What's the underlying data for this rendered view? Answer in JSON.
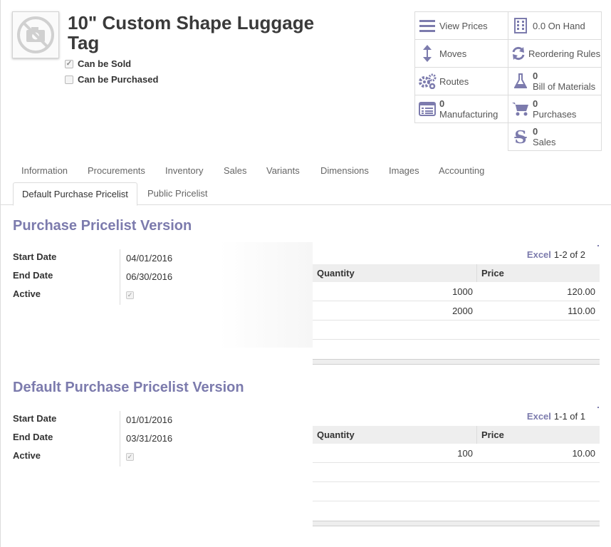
{
  "product": {
    "title": "10\" Custom Shape Luggage Tag",
    "can_be_sold_label": "Can be Sold",
    "can_be_sold": true,
    "can_be_purchased_label": "Can be Purchased",
    "can_be_purchased": false
  },
  "smart_buttons": {
    "view_prices": "View Prices",
    "on_hand": "0.0 On Hand",
    "moves": "Moves",
    "reordering_rules": "Reordering Rules",
    "routes": "Routes",
    "bom_count": "0",
    "bom_label": "Bill of Materials",
    "manufacturing_count": "0",
    "manufacturing_label": "Manufacturing",
    "purchases_count": "0",
    "purchases_label": "Purchases",
    "sales_count": "0",
    "sales_label": "Sales"
  },
  "tabs": [
    "Information",
    "Procurements",
    "Inventory",
    "Sales",
    "Variants",
    "Dimensions",
    "Images",
    "Accounting"
  ],
  "subtabs": [
    "Default Purchase Pricelist",
    "Public Pricelist"
  ],
  "sections": [
    {
      "title": "Purchase Pricelist Version",
      "start_date_label": "Start Date",
      "start_date": "04/01/2016",
      "end_date_label": "End Date",
      "end_date": "06/30/2016",
      "active_label": "Active",
      "active": true,
      "excel": "Excel",
      "pager": "1-2 of 2",
      "columns": [
        "Quantity",
        "Price"
      ],
      "rows": [
        [
          "1000",
          "120.00"
        ],
        [
          "2000",
          "110.00"
        ]
      ]
    },
    {
      "title": "Default Purchase Pricelist Version",
      "start_date_label": "Start Date",
      "start_date": "01/01/2016",
      "end_date_label": "End Date",
      "end_date": "03/31/2016",
      "active_label": "Active",
      "active": true,
      "excel": "Excel",
      "pager": "1-1 of 1",
      "columns": [
        "Quantity",
        "Price"
      ],
      "rows": [
        [
          "100",
          "10.00"
        ]
      ]
    }
  ],
  "colors": {
    "accent": "#7c7bad",
    "border": "#dcdcdc"
  }
}
